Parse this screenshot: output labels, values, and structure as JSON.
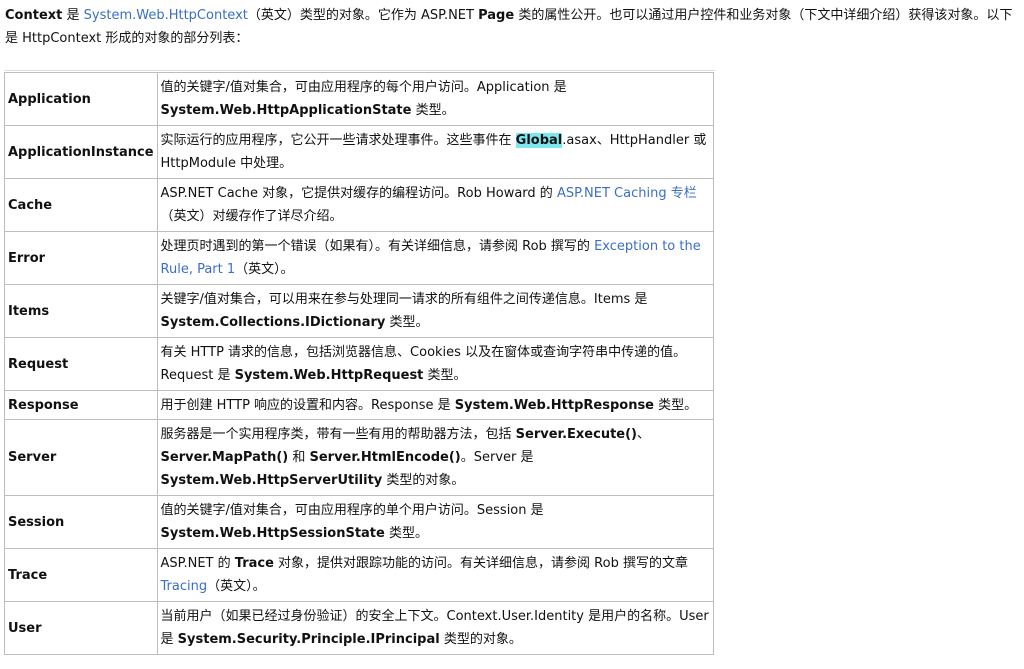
{
  "intro": {
    "p1": "Context",
    "p2": " 是 ",
    "p3": "System.Web.HttpContext",
    "p4": "（英文）类型的对象。它作为 ASP.NET ",
    "p5": "Page",
    "p6": " 类的属性公开。也可以通过用户控件和业务对象（下文中详细介绍）获得该对象。以下是 HttpContext 形成的对象的部分列表："
  },
  "rows": [
    {
      "key": "Application",
      "a": "值的关键字/值对集合，可由应用程序的每个用户访问。Application 是 ",
      "b": "System.Web.HttpApplicationState",
      "c": " 类型。"
    },
    {
      "key": "ApplicationInstance",
      "a": "实际运行的应用程序，它公开一些请求处理事件。这些事件在 ",
      "hl": "Global",
      "b": ".asax、HttpHandler 或 HttpModule 中处理。"
    },
    {
      "key": "Cache",
      "a": "ASP.NET Cache 对象，它提供对缓存的编程访问。Rob Howard 的 ",
      "link": "ASP.NET Caching 专栏",
      "c": "（英文）对缓存作了详尽介绍。"
    },
    {
      "key": "Error",
      "a": "处理页时遇到的第一个错误（如果有）。有关详细信息，请参阅 Rob 撰写的 ",
      "link": "Exception to the Rule, Part 1",
      "c": "（英文）。"
    },
    {
      "key": "Items",
      "a": "关键字/值对集合，可以用来在参与处理同一请求的所有组件之间传递信息。Items 是 ",
      "b": "System.Collections.IDictionary",
      "c": " 类型。"
    },
    {
      "key": "Request",
      "a": "有关 HTTP 请求的信息，包括浏览器信息、Cookies 以及在窗体或查询字符串中传递的值。Request 是 ",
      "b": "System.Web.HttpRequest",
      "c": " 类型。"
    },
    {
      "key": "Response",
      "a": "用于创建 HTTP 响应的设置和内容。Response 是 ",
      "b": "System.Web.HttpResponse",
      "c": " 类型。"
    },
    {
      "key": "Server",
      "a": "服务器是一个实用程序类，带有一些有用的帮助器方法，包括 ",
      "b1": "Server.Execute()",
      "s1": "、",
      "b2": "Server.MapPath()",
      "s2": " 和 ",
      "b3": "Server.HtmlEncode()",
      "s3": "。Server 是 ",
      "b4": "System.Web.HttpServerUtility",
      "c": " 类型的对象。"
    },
    {
      "key": "Session",
      "a": "值的关键字/值对集合，可由应用程序的单个用户访问。Session 是 ",
      "b": "System.Web.HttpSessionState",
      "c": " 类型。"
    },
    {
      "key": "Trace",
      "a": "ASP.NET 的 ",
      "b": "Trace",
      "a2": " 对象，提供对跟踪功能的访问。有关详细信息，请参阅 Rob 撰写的文章 ",
      "link": "Tracing",
      "c": "（英文）。"
    },
    {
      "key": "User",
      "a": "当前用户（如果已经过身份验证）的安全上下文。Context.User.Identity 是用户的名称。User 是 ",
      "b": "System.Security.Principle.IPrincipal",
      "c": " 类型的对象。"
    }
  ]
}
